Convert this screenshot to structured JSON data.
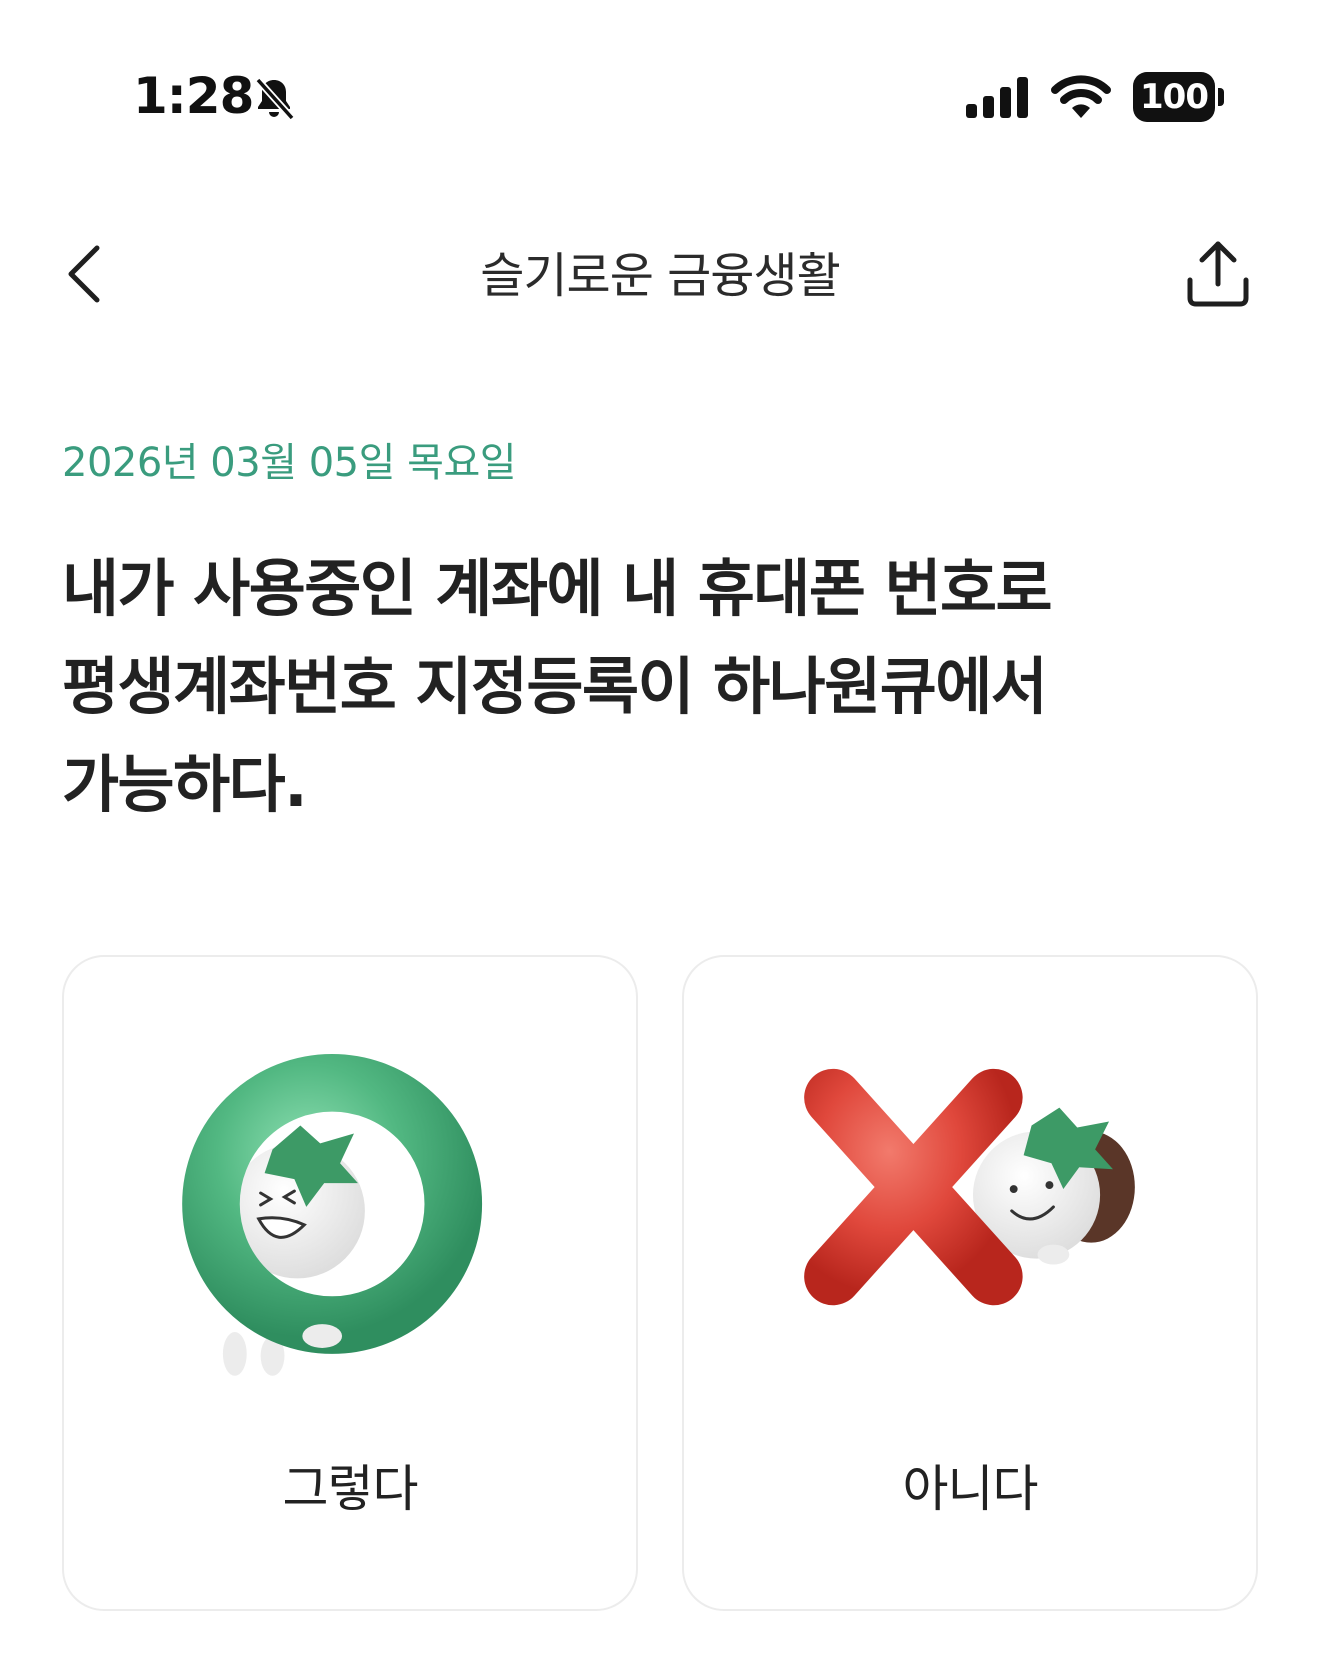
{
  "status_bar": {
    "time": "1:28",
    "battery": "100",
    "icons": [
      "bell-slash-icon",
      "cellular-signal-icon",
      "wifi-icon",
      "battery-icon"
    ]
  },
  "nav": {
    "title": "슬기로운 금융생활",
    "back_icon": "chevron-left-icon",
    "share_icon": "share-icon"
  },
  "quiz": {
    "date": "2026년 03월 05일 목요일",
    "question_lines": [
      "내가 사용중인 계좌에 내 휴대폰 번호로",
      "평생계좌번호 지정등록이 하나원큐에서",
      "가능하다."
    ],
    "answers": [
      {
        "label": "그렇다",
        "icon": "o-ring-character-icon",
        "color": "#52b882"
      },
      {
        "label": "아니다",
        "icon": "x-mark-character-icon",
        "color": "#e0483c"
      }
    ]
  },
  "colors": {
    "accent_green": "#3a9c7e",
    "text_dark": "#222222",
    "card_border": "#ececec"
  }
}
